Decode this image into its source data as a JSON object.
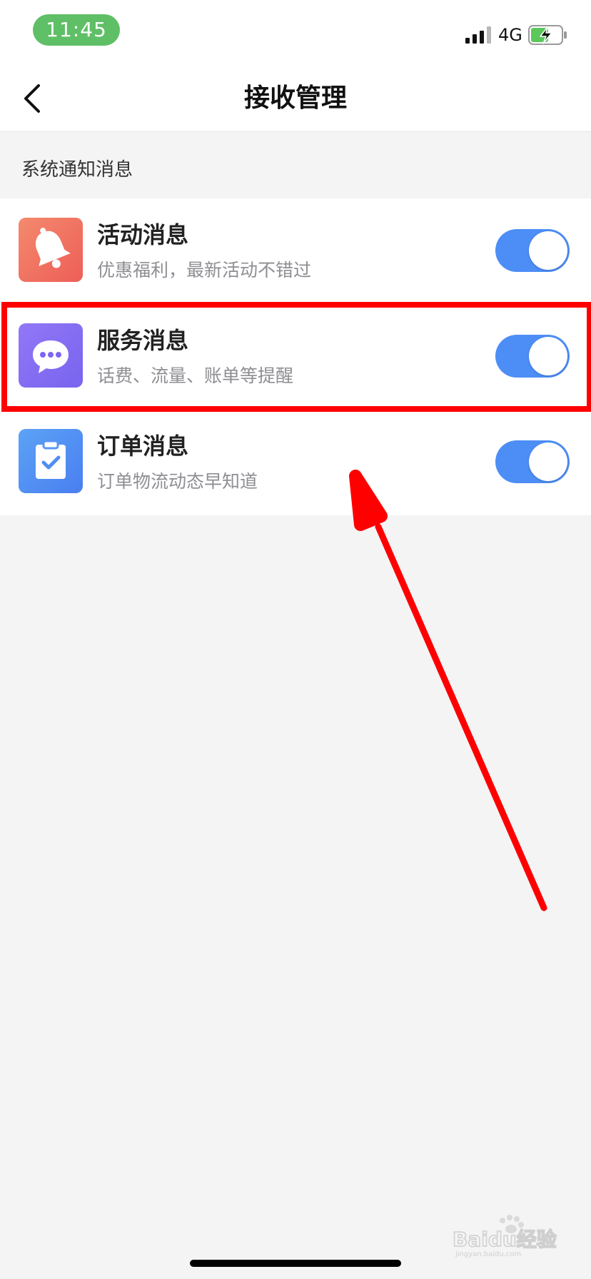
{
  "status_bar": {
    "time": "11:45",
    "network": "4G",
    "signal_icon": "signal-bars-icon",
    "battery_icon": "battery-charging-icon"
  },
  "nav": {
    "title": "接收管理",
    "back_icon": "chevron-left-icon"
  },
  "section": {
    "header": "系统通知消息"
  },
  "items": [
    {
      "title": "活动消息",
      "subtitle": "优惠福利，最新活动不错过",
      "icon": "bell-icon",
      "icon_color": "#ee6a5e",
      "enabled": true
    },
    {
      "title": "服务消息",
      "subtitle": "话费、流量、账单等提醒",
      "icon": "chat-bubble-icon",
      "icon_color": "#8168f2",
      "enabled": true
    },
    {
      "title": "订单消息",
      "subtitle": "订单物流动态早知道",
      "icon": "clipboard-check-icon",
      "icon_color": "#4f8ef4",
      "enabled": true
    }
  ],
  "colors": {
    "toggle_on": "#4d8ef6",
    "annotation": "#ff0000",
    "time_pill": "#5fbf66"
  },
  "watermark": {
    "text": "Baidu经验",
    "subtext": "jingyan.baidu.com"
  }
}
